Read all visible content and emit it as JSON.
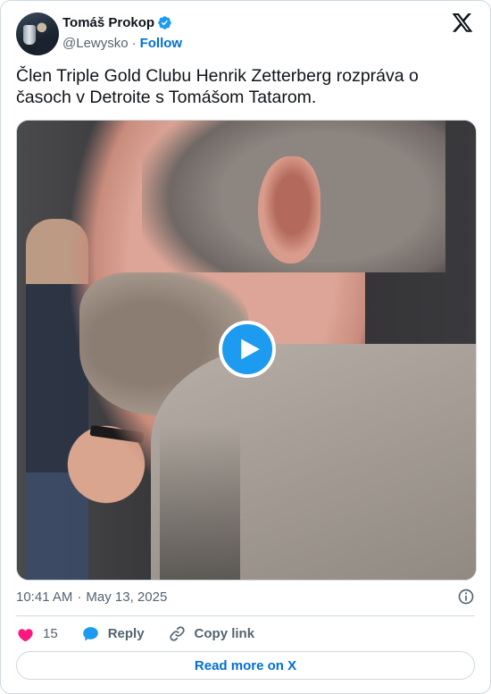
{
  "author": {
    "name": "Tomáš Prokop",
    "handle": "@Lewysko",
    "separator": "·",
    "follow_label": "Follow"
  },
  "tweet": {
    "text": "Člen Triple Gold Clubu Henrik Zetterberg rozpráva o časoch v Detroite s Tomášom Tatarom."
  },
  "meta": {
    "time": "10:41 AM",
    "separator": "·",
    "date": "May 13, 2025"
  },
  "actions": {
    "like_count": "15",
    "reply_label": "Reply",
    "copy_label": "Copy link"
  },
  "read_more_label": "Read more on X",
  "colors": {
    "accent": "#1d9bf0",
    "link": "#006fd6",
    "like": "#f91880",
    "muted": "#536471",
    "border": "#cfd9de"
  },
  "icons": {
    "verified": "verified-badge-icon",
    "logo": "x-logo-icon",
    "play": "play-icon",
    "info": "info-icon",
    "like": "heart-icon",
    "reply": "speech-bubble-icon",
    "copy": "link-icon"
  }
}
